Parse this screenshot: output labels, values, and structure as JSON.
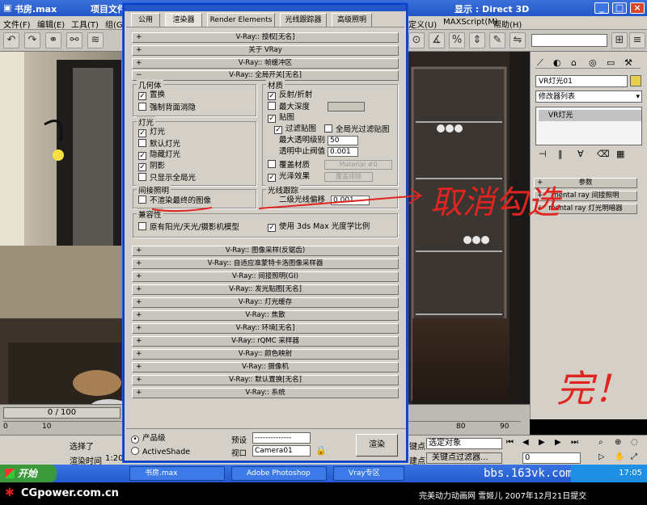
{
  "app": {
    "title_left": "书房.max",
    "title_mid": "项目文件",
    "title_right": "显示 : Direct 3D",
    "title_menu": "帮助(H)"
  },
  "menubar": {
    "items": [
      "文件(F)",
      "编辑(E)",
      "工具(T)",
      "组(G)",
      "定义(U)",
      "MAXScript(M)"
    ]
  },
  "dialog": {
    "tabs": [
      "公用",
      "渲染器",
      "Render Elements",
      "光线跟踪器",
      "高级照明"
    ],
    "rollouts_top": [
      "V-Ray:: 授权[无名]",
      "关于 VRay",
      "V-Ray:: 帧缓冲区"
    ],
    "global_switches_title": "V-Ray:: 全局开关[无名]",
    "geometry": {
      "title": "几何体",
      "displacement": "置换",
      "backface": "强制背面消隐"
    },
    "lights": {
      "title": "灯光",
      "lights": "灯光",
      "default_lights": "默认灯光",
      "hidden_lights": "隐藏灯光",
      "shadows": "阴影",
      "show_gi_only": "只显示全局光"
    },
    "materials": {
      "title": "材质",
      "reflect_refract": "反射/折射",
      "max_depth": "最大深度",
      "maps": "贴图",
      "filter_maps": "过滤贴图",
      "filter_maps_gi": "全局光过滤贴图",
      "max_transp_levels": "最大透明级别",
      "max_transp_value": "50",
      "transp_cutoff": "透明中止阀值",
      "transp_cutoff_value": "0.001",
      "override_mtl": "覆盖材质",
      "override_mtl_btn": "Material #0",
      "glossy_effects": "光泽效果",
      "override_exclude": "覆盖排除"
    },
    "indirect": {
      "title": "间接照明",
      "dont_render_final": "不渲染最终的图像"
    },
    "raytracing": {
      "title": "光线跟踪",
      "secondary_bias": "二级光线偏移",
      "secondary_bias_value": "0.001"
    },
    "compat": {
      "title": "兼容性",
      "legacy": "原有阳光/天光/摄影机模型",
      "use_3dsmax": "使用 3ds Max 光度学比例"
    },
    "rollouts_bottom": [
      "V-Ray:: 图像采样(反锯齿)",
      "V-Ray:: 自适应准蒙特卡洛图像采样器",
      "V-Ray:: 间接照明(GI)",
      "V-Ray:: 发光贴图[无名]",
      "V-Ray:: 灯光缓存",
      "V-Ray:: 焦散",
      "V-Ray:: 环境[无名]",
      "V-Ray:: rQMC 采样器",
      "V-Ray:: 颜色映射",
      "V-Ray:: 摄像机",
      "V-Ray:: 默认置换[无名]",
      "V-Ray:: 系统"
    ],
    "bottom": {
      "production": "产品级",
      "activeshade": "ActiveShade",
      "preset_label": "预设",
      "preset_value": "--------------",
      "viewport_label": "视口",
      "viewport_value": "Camera01",
      "render_button": "渲染"
    }
  },
  "right_panel": {
    "object_name": "VR灯光01",
    "modifier_list": "修改器列表",
    "stack_item": "VR灯光",
    "rollouts": [
      "参数",
      "mental ray 间接照明",
      "mental ray 灯光明暗器"
    ]
  },
  "timeline": {
    "frame": "0 / 100",
    "ticks": [
      "0",
      "10",
      "20",
      "30",
      "40",
      "50",
      "60",
      "70",
      "80",
      "90",
      "100"
    ]
  },
  "status": {
    "select_label": "选择了",
    "render_time_label": "渲染时间",
    "render_time_value": "1:20",
    "keypoint_label": "键点",
    "selected_object": "选定对象",
    "keyfilter_label": "关键点过滤器...",
    "auto_key": "建点",
    "frame_value": "0"
  },
  "taskbar": {
    "start": "开始",
    "buttons": [
      "书房.max",
      "Adobe Photoshop",
      "Vray专区"
    ],
    "watermark": "bbs.163vk.com",
    "time": "17:05"
  },
  "annotations": {
    "arrow_text": "取消勾选",
    "done_text": "完！"
  },
  "footer": {
    "logo": "CGpower.com.cn",
    "credit": "完美动力动画网 雪姬儿 2007年12月21日提交"
  },
  "colors": {
    "titlebar": "#2357c8",
    "panel": "#d4d0c8",
    "annotation": "#e0241f"
  }
}
